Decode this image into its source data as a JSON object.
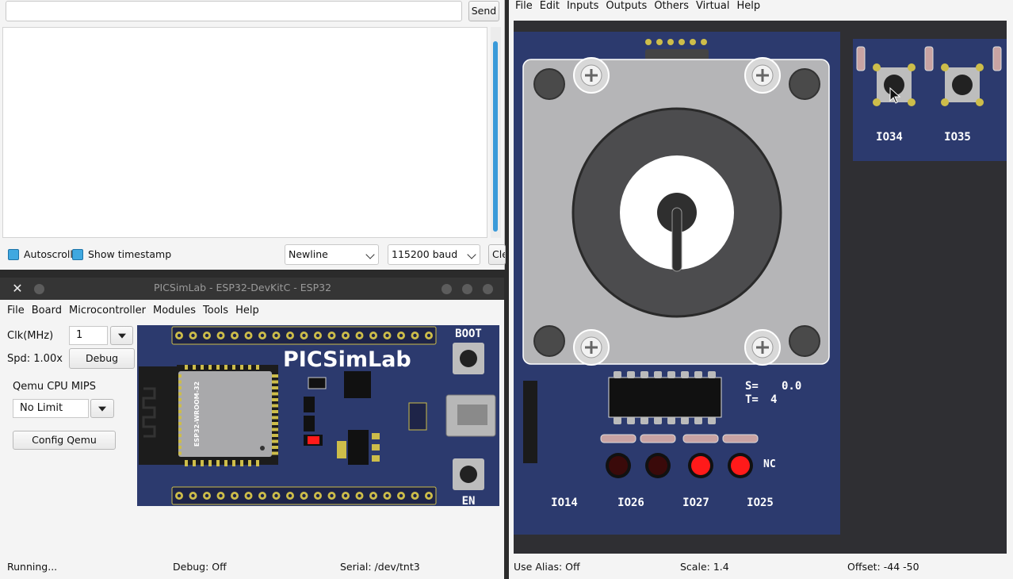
{
  "serial_monitor": {
    "input_value": "",
    "send_label": "Send",
    "autoscroll_label": "Autoscroll",
    "timestamp_label": "Show timestamp",
    "line_ending": "Newline",
    "baud_rate": "115200 baud",
    "clear_label": "Cle"
  },
  "main_window": {
    "title": "PICSimLab - ESP32-DevKitC - ESP32",
    "menu": [
      "File",
      "Board",
      "Microcontroller",
      "Modules",
      "Tools",
      "Help"
    ],
    "clk_label": "Clk(MHz)",
    "clk_value": "1",
    "spd_label": "Spd: 1.00x",
    "debug_label": "Debug",
    "mips_label": "Qemu CPU MIPS",
    "mips_value": "No Limit",
    "config_label": "Config Qemu",
    "status": {
      "running": "Running...",
      "debug": "Debug: Off",
      "serial": "Serial: /dev/tnt3"
    },
    "board": {
      "logo": "PICSimLab",
      "module_label": "ESP32-WROOM-32",
      "boot_label": "BOOT",
      "en_label": "EN"
    }
  },
  "spare_parts": {
    "menu": [
      "File",
      "Edit",
      "Inputs",
      "Outputs",
      "Others",
      "Virtual",
      "Help"
    ],
    "stepper": {
      "s_label": "S=",
      "s_value": "0.0",
      "t_label": "T=",
      "t_value": "4",
      "pin_labels": [
        "IO14",
        "IO26",
        "IO27",
        "IO25"
      ],
      "nc_label": "NC",
      "led_states": [
        false,
        false,
        true,
        true
      ]
    },
    "buttons": {
      "labels": [
        "IO34",
        "IO35"
      ]
    },
    "status": {
      "alias": "Use Alias: Off",
      "scale": "Scale: 1.4",
      "offset": "Offset: -44 -50"
    }
  },
  "colors": {
    "pcb_blue": "#2c3a6e",
    "led_on": "#ff1a1a",
    "led_off": "#3a0a0a",
    "checkbox": "#3fa8e0"
  }
}
